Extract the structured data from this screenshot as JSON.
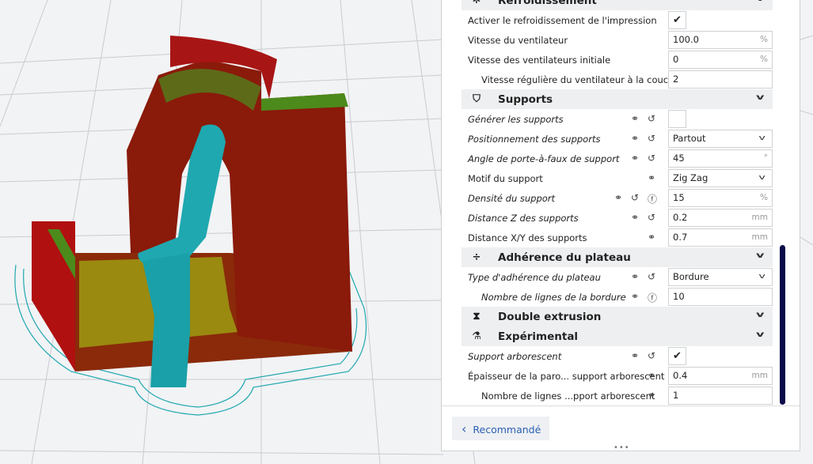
{
  "sections": [
    {
      "type": "header",
      "label": "Refroidissement",
      "icon": "fan-icon",
      "glyph": "✲"
    },
    {
      "type": "checkbox",
      "label": "Activer le refroidissement de l'impression",
      "checked": true
    },
    {
      "type": "number",
      "label": "Vitesse du ventilateur",
      "value": "100.0",
      "unit": "%"
    },
    {
      "type": "number",
      "label": "Vitesse des ventilateurs initiale",
      "value": "0",
      "unit": "%"
    },
    {
      "type": "number",
      "label": "Vitesse régulière du ventilateur à la couche",
      "value": "2",
      "unit": "",
      "indent": true
    },
    {
      "type": "header",
      "label": "Supports",
      "icon": "support-icon",
      "glyph": "⛉"
    },
    {
      "type": "checkbox",
      "label": "Générer les supports",
      "checked": false,
      "italic": true,
      "icons": [
        "link",
        "reset"
      ]
    },
    {
      "type": "select",
      "label": "Positionnement des supports",
      "value": "Partout",
      "italic": true,
      "icons": [
        "link",
        "reset"
      ]
    },
    {
      "type": "number",
      "label": "Angle de porte-à-faux de support",
      "value": "45",
      "unit": "°",
      "italic": true,
      "icons": [
        "link",
        "reset"
      ]
    },
    {
      "type": "select",
      "label": "Motif du support",
      "value": "Zig Zag",
      "icons": [
        "link"
      ]
    },
    {
      "type": "number",
      "label": "Densité du support",
      "value": "15",
      "unit": "%",
      "italic": true,
      "icons": [
        "link",
        "reset",
        "function"
      ]
    },
    {
      "type": "number",
      "label": "Distance Z des supports",
      "value": "0.2",
      "unit": "mm",
      "italic": true,
      "icons": [
        "link",
        "reset"
      ]
    },
    {
      "type": "number",
      "label": "Distance X/Y des supports",
      "value": "0.7",
      "unit": "mm",
      "icons": [
        "link"
      ]
    },
    {
      "type": "header",
      "label": "Adhérence du plateau",
      "icon": "adhesion-icon",
      "glyph": "÷"
    },
    {
      "type": "select",
      "label": "Type d'adhérence du plateau",
      "value": "Bordure",
      "italic": true,
      "icons": [
        "link",
        "reset"
      ]
    },
    {
      "type": "number",
      "label": "Nombre de lignes de la bordure",
      "value": "10",
      "unit": "",
      "italic": true,
      "indent": true,
      "icons": [
        "link",
        "function"
      ]
    },
    {
      "type": "header",
      "label": "Double extrusion",
      "icon": "dual-extrusion-icon",
      "glyph": "⧗"
    },
    {
      "type": "header",
      "label": "Expérimental",
      "icon": "flask-icon",
      "glyph": "⚗"
    },
    {
      "type": "checkbox",
      "label": "Support arborescent",
      "checked": true,
      "italic": true,
      "icons": [
        "link",
        "reset"
      ]
    },
    {
      "type": "number",
      "label": "Épaisseur de la paro... support arborescent",
      "value": "0.4",
      "unit": "mm",
      "icons": [
        "link"
      ]
    },
    {
      "type": "number",
      "label": "Nombre de lignes ...pport arborescent",
      "value": "1",
      "unit": "",
      "indent": true,
      "icons": [
        "link"
      ]
    }
  ],
  "footer": {
    "recommended_label": "Recommandé",
    "chevron": "‹",
    "handle": "•••"
  },
  "colors": {
    "accent": "#2a5fb0",
    "scrollbar": "#0b0b4a",
    "model_red": "#b01010",
    "model_green": "#4c8a1c",
    "support_cyan": "#1fa8b0"
  }
}
